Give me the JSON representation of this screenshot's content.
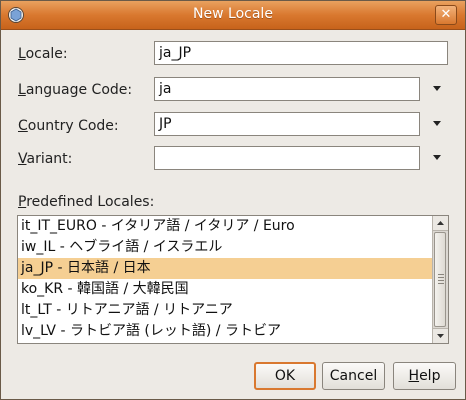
{
  "window": {
    "title": "New Locale"
  },
  "form": {
    "locale": {
      "label_first": "L",
      "label_rest": "ocale:",
      "value": "ja_JP"
    },
    "language_code": {
      "label_first": "L",
      "label_rest": "anguage Code:",
      "value": "ja"
    },
    "country_code": {
      "label_first": "C",
      "label_rest": "ountry Code:",
      "value": "JP"
    },
    "variant": {
      "label_first": "V",
      "label_rest": "ariant:",
      "value": ""
    }
  },
  "predefined": {
    "label_first": "P",
    "label_rest": "redefined Locales:",
    "items": [
      "it_IT_EURO - イタリア語 / イタリア / Euro",
      "iw_IL - ヘブライ語 / イスラエル",
      "ja_JP - 日本語 / 日本",
      "ko_KR - 韓国語 / 大韓民国",
      "lt_LT - リトアニア語 / リトアニア",
      "lv_LV - ラトビア語 (レット語) / ラトビア"
    ],
    "selected_index": 2
  },
  "buttons": {
    "ok": "OK",
    "cancel": "Cancel",
    "help_first": "H",
    "help_rest": "elp"
  },
  "icons": {
    "app": "java-cup-icon",
    "close": "close-icon",
    "combo": "chevron-down-icon"
  },
  "colors": {
    "titlebar": "#d9782f",
    "selection": "#f5cf93",
    "default_button_border": "#d9782f"
  }
}
